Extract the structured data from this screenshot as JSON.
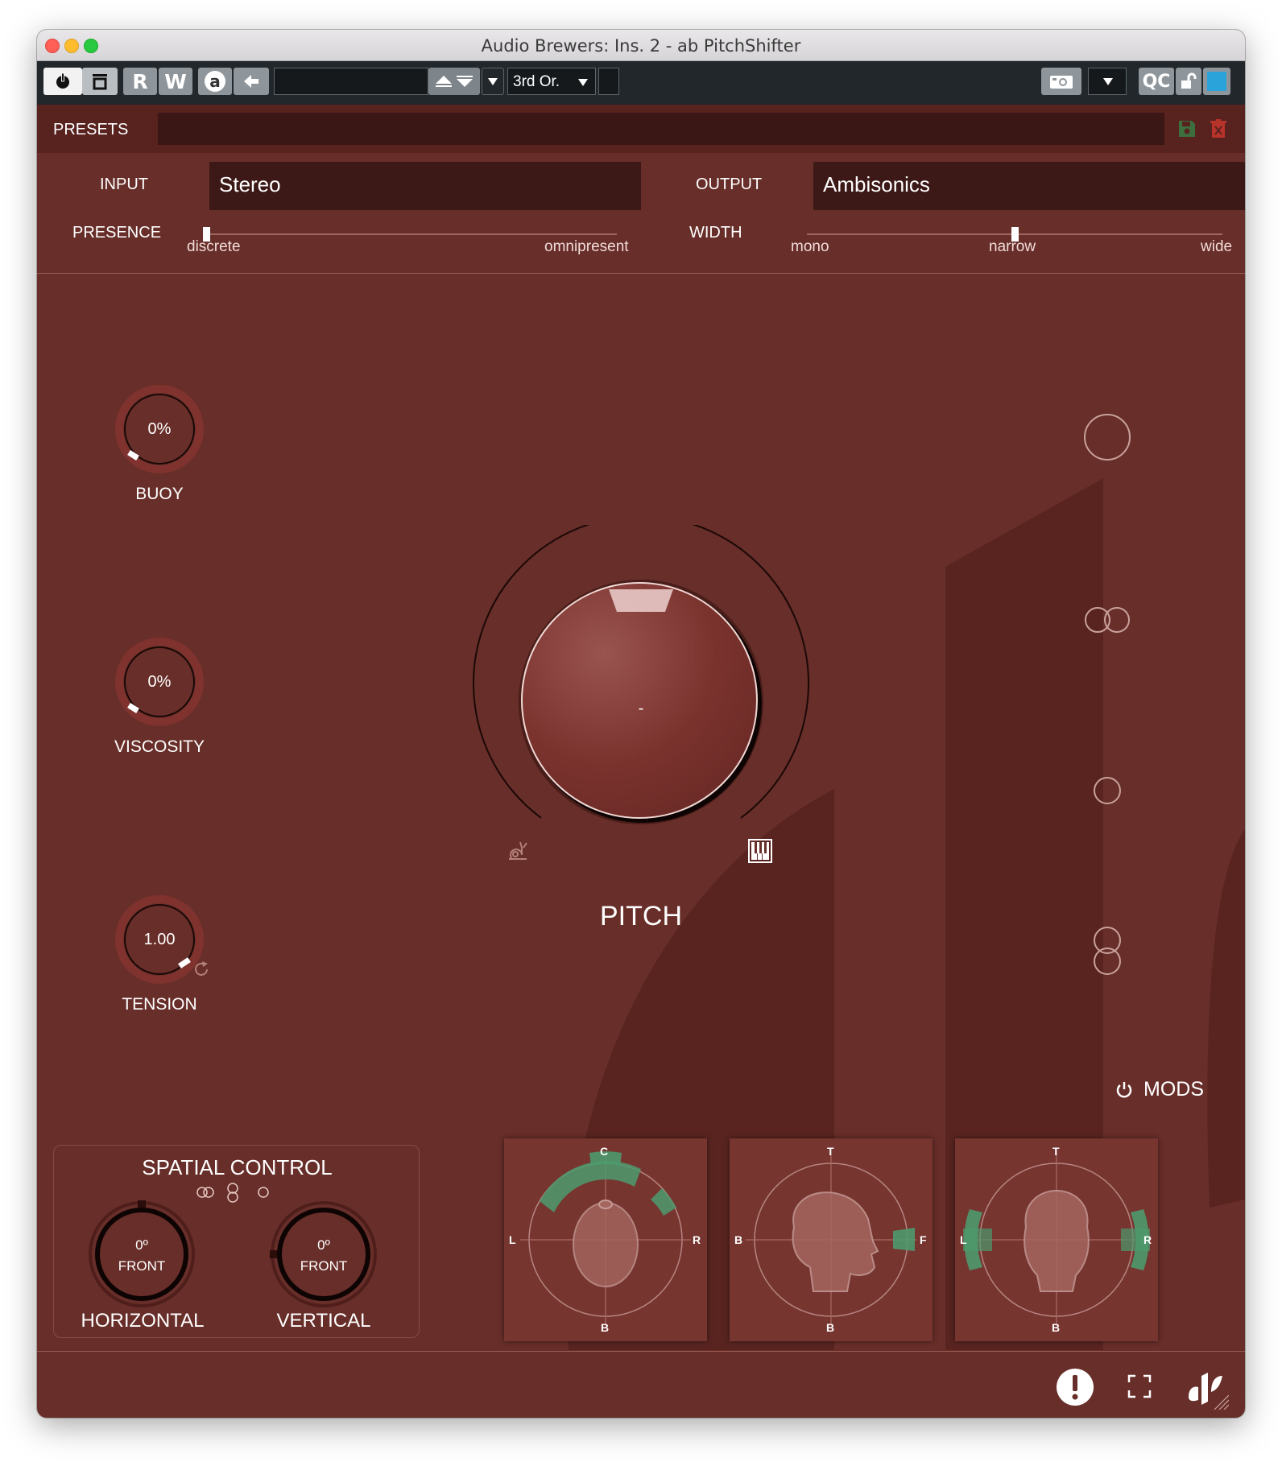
{
  "window": {
    "title": "Audio Brewers: Ins. 2 - ab PitchShifter"
  },
  "toolbar": {
    "read_label": "R",
    "write_label": "W",
    "auto_label": "a",
    "preset_field": "",
    "order_select": "3rd Or.",
    "qc_label": "QC"
  },
  "presets": {
    "label": "PRESETS",
    "value": ""
  },
  "io": {
    "input_label": "INPUT",
    "input_value": "Stereo",
    "output_label": "OUTPUT",
    "output_value": "Ambisonics"
  },
  "presence": {
    "label": "PRESENCE",
    "min_label": "discrete",
    "max_label": "omnipresent",
    "value": 0.0
  },
  "width": {
    "label": "WIDTH",
    "min_label": "mono",
    "mid_label": "narrow",
    "max_label": "wide",
    "value": 0.5
  },
  "knobs": {
    "buoy": {
      "label": "BUOY",
      "value": "0%"
    },
    "viscosity": {
      "label": "VISCOSITY",
      "value": "0%"
    },
    "tension": {
      "label": "TENSION",
      "value": "1.00"
    }
  },
  "pitch": {
    "label": "PITCH",
    "value": "-"
  },
  "mods": {
    "label": "MODS"
  },
  "spatial": {
    "title": "SPATIAL CONTROL",
    "horizontal": {
      "label": "HORIZONTAL",
      "angle": "0º",
      "direction": "FRONT"
    },
    "vertical": {
      "label": "VERTICAL",
      "angle": "0º",
      "direction": "FRONT"
    }
  },
  "panels": {
    "top_view": {
      "top": "C",
      "left": "L",
      "right": "R",
      "bottom": "B"
    },
    "side_view": {
      "top": "T",
      "left": "B",
      "right": "F",
      "bottom": "B"
    },
    "front_view": {
      "top": "T",
      "left": "L",
      "right": "R",
      "bottom": "B"
    }
  },
  "colors": {
    "background": "#682e29",
    "accent_green": "#4c9a6e",
    "toolbar": "#22272b"
  }
}
